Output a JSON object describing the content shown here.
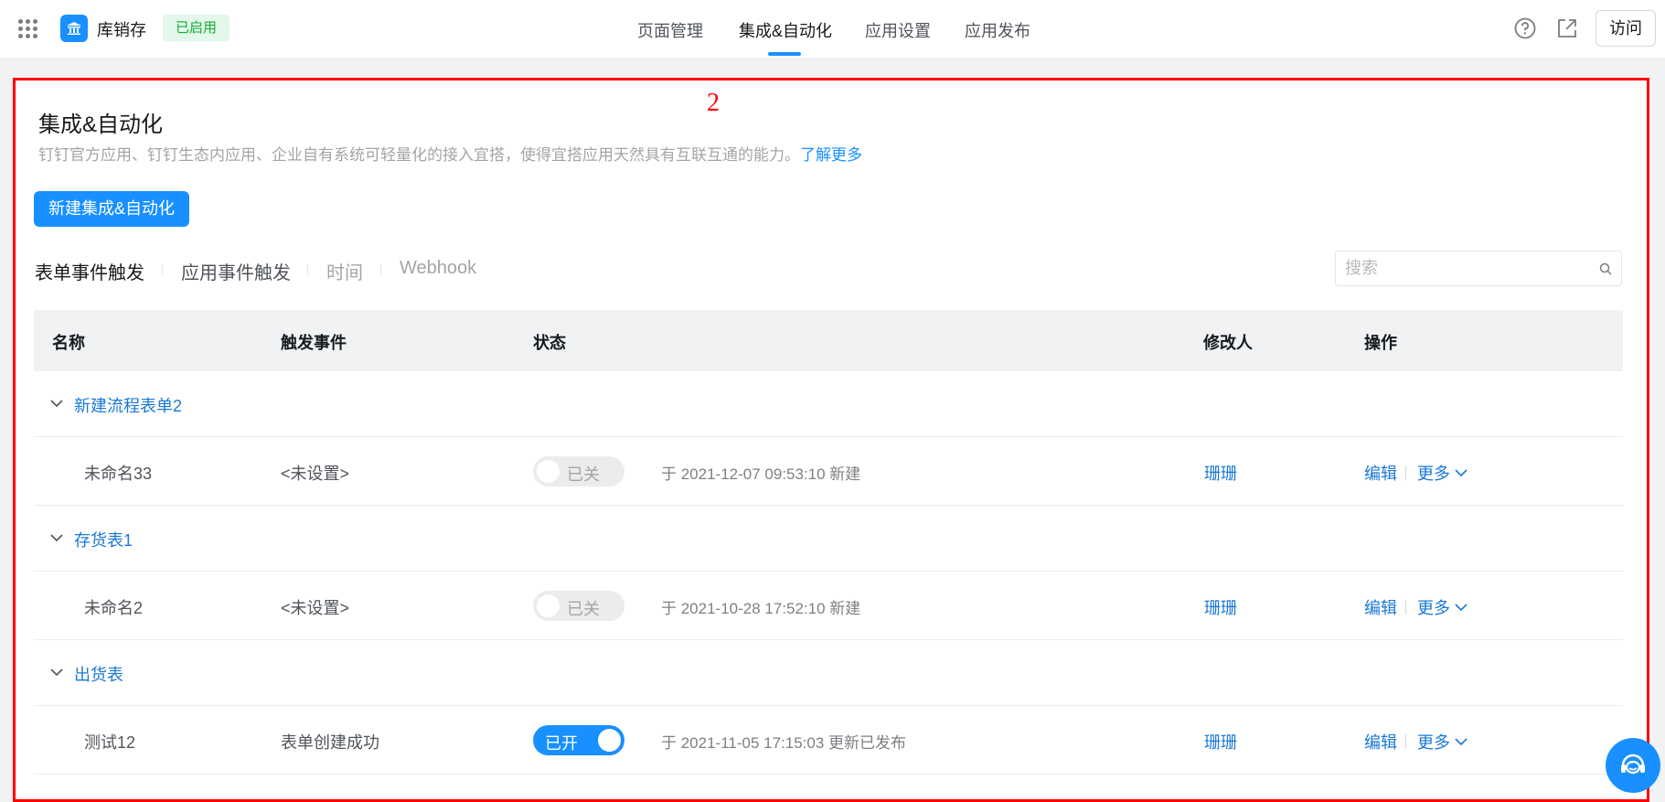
{
  "header": {
    "app_name": "库销存",
    "app_status": "已启用",
    "tabs": [
      {
        "label": "页面管理"
      },
      {
        "label": "集成&自动化"
      },
      {
        "label": "应用设置"
      },
      {
        "label": "应用发布"
      }
    ],
    "active_tab": "集成&自动化",
    "visit_label": "访问"
  },
  "annotation": {
    "number": "2"
  },
  "main": {
    "title": "集成&自动化",
    "description": "钉钉官方应用、钉钉生态内应用、企业自有系统可轻量化的接入宜搭，使得宜搭应用天然具有互联互通的能力。",
    "learn_more": "了解更多",
    "new_button": "新建集成&自动化",
    "filter_tabs": [
      {
        "label": "表单事件触发"
      },
      {
        "label": "应用事件触发"
      },
      {
        "label": "时间"
      },
      {
        "label": "Webhook"
      }
    ],
    "search": {
      "placeholder": "搜索",
      "value": ""
    },
    "columns": {
      "name": "名称",
      "trigger": "触发事件",
      "status": "状态",
      "modifier": "修改人",
      "actions": "操作"
    },
    "groups": [
      {
        "name": "新建流程表单2",
        "rows": [
          {
            "name": "未命名33",
            "event": "<未设置>",
            "status": "已关",
            "enabled": false,
            "time": "于 2021-12-07 09:53:10 新建",
            "modifier": "珊珊",
            "edit": "编辑",
            "more": "更多"
          }
        ]
      },
      {
        "name": "存货表1",
        "rows": [
          {
            "name": "未命名2",
            "event": "<未设置>",
            "status": "已关",
            "enabled": false,
            "time": "于 2021-10-28 17:52:10 新建",
            "modifier": "珊珊",
            "edit": "编辑",
            "more": "更多"
          }
        ]
      },
      {
        "name": "出货表",
        "rows": [
          {
            "name": "测试12",
            "event": "表单创建成功",
            "status": "已开",
            "enabled": true,
            "time": "于 2021-11-05 17:15:03 更新已发布",
            "modifier": "珊珊",
            "edit": "编辑",
            "more": "更多"
          }
        ]
      }
    ]
  },
  "icons": {
    "app_switcher": "grid-icon",
    "app_logo": "building-icon",
    "help": "question-circle-icon",
    "external": "external-link-icon",
    "search": "search-icon",
    "chat": "customer-service-icon"
  },
  "colors": {
    "primary": "#1890ff",
    "link": "#1a78d6",
    "status_badge_bg": "#e3f7ea",
    "status_badge_text": "#15ad31",
    "annotation": "#ff0000"
  }
}
